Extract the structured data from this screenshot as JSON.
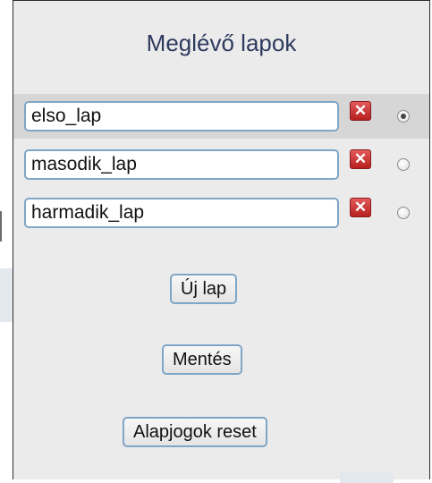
{
  "panel": {
    "title": "Meglévő lapok",
    "pages": [
      {
        "name": "elso_lap",
        "selected": true
      },
      {
        "name": "masodik_lap",
        "selected": false
      },
      {
        "name": "harmadik_lap",
        "selected": false
      }
    ],
    "delete_glyph": "✕",
    "buttons": {
      "new_page": "Új lap",
      "save": "Mentés",
      "reset": "Alapjogok reset"
    }
  },
  "colors": {
    "panel_bg": "#ebebeb",
    "selected_row_bg": "#d6d6d6",
    "title_text": "#2e3a5e",
    "delete_button": "#d43030",
    "input_border": "#7fa6c7"
  }
}
